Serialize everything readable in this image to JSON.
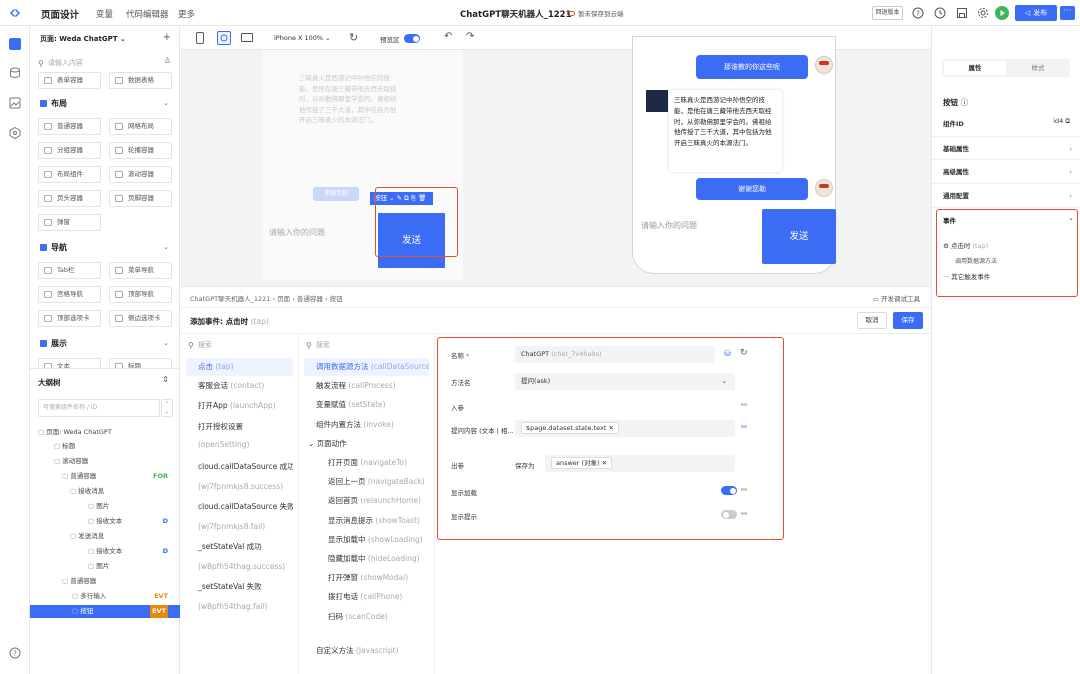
{
  "topbar": {
    "title": "页面设计",
    "nav": [
      "变量",
      "代码编辑器",
      "更多"
    ],
    "app_name": "ChatGPT聊天机器人_1221",
    "save_status": "暂未保存到云端",
    "rollback_label": "回退版本",
    "publish_label": "发布"
  },
  "comp_panel": {
    "page_selector": "页面: Weda ChatGPT",
    "search_placeholder": "请输入内容",
    "top_items": [
      "表单容器",
      "数据表格"
    ],
    "categories": [
      {
        "name": "布局",
        "items": [
          "普通容器",
          "网格布局",
          "分组容器",
          "轮播容器",
          "布局组件",
          "滚动容器",
          "页头容器",
          "页脚容器",
          "弹窗"
        ]
      },
      {
        "name": "导航",
        "items": [
          "Tab栏",
          "菜单导航",
          "宫格导航",
          "顶部导航",
          "顶部选项卡",
          "侧边选项卡"
        ]
      },
      {
        "name": "展示",
        "items": [
          "文本",
          "标题"
        ]
      }
    ]
  },
  "outline": {
    "title": "大纲树",
    "search_placeholder": "可搜索组件名称 / ID",
    "nodes": [
      {
        "label": "页面: Weda ChatGPT",
        "tag": ""
      },
      {
        "label": "标题",
        "tag": ""
      },
      {
        "label": "滚动容器",
        "tag": ""
      },
      {
        "label": "普通容器",
        "tag": "FOR"
      },
      {
        "label": "接收消息",
        "tag": ""
      },
      {
        "label": "图片",
        "tag": ""
      },
      {
        "label": "接收文本",
        "tag": "D"
      },
      {
        "label": "发送消息",
        "tag": ""
      },
      {
        "label": "接收文本",
        "tag": "D"
      },
      {
        "label": "图片",
        "tag": ""
      },
      {
        "label": "普通容器",
        "tag": ""
      },
      {
        "label": "多行输入",
        "tag": "EVT"
      },
      {
        "label": "按钮",
        "tag": "EVT"
      }
    ]
  },
  "canvas": {
    "device": "iPhone X 100%",
    "preview_label": "预览区",
    "left_preview": {
      "received_text": "三昧真火是西游记中孙悟空的技能，是他在唐三藏带他去西天取经时，从孙勤佛那里学会的。佛祖给他传授了三千大道，其中包括为他开启三昧真火的本源法门。",
      "sent_text": "谢谢您勒",
      "input_placeholder": "请输入你的问题",
      "send_label": "发送",
      "selection_label": "按钮"
    },
    "phone": {
      "msg1": "那谁教的你这些呢",
      "received_text": "三昧真火是西游记中孙悟空的技能，是他在唐三藏带他去西天取经时，从弥勒佛那里学会的。佛祖给他传授了三千大道，其中包括为他开启三昧真火的本源法门。",
      "msg2": "谢谢您勒",
      "input_placeholder": "请输入你的问题",
      "send_label": "发送"
    }
  },
  "editor": {
    "breadcrumb": [
      "ChatGPT聊天机器人_1221",
      "页面",
      "普通容器",
      "按钮"
    ],
    "dev_tools_label": "开发调试工具",
    "title": "添加事件: 点击时",
    "title_sub": "(tap)",
    "cancel_label": "取消",
    "save_label": "保存",
    "search_placeholder": "搜索",
    "events": [
      {
        "name": "点击",
        "code": "(tap)"
      },
      {
        "name": "客服会话",
        "code": "(contact)"
      },
      {
        "name": "打开App",
        "code": "(launchApp)"
      },
      {
        "name": "打开授权设置",
        "code": ""
      },
      {
        "name": "",
        "code": "(openSetting)"
      },
      {
        "name": "cloud.callDataSource 成功",
        "code": ""
      },
      {
        "name": "",
        "code": "(wj7fpnmkjs8.success)"
      },
      {
        "name": "cloud.callDataSource 失败",
        "code": ""
      },
      {
        "name": "",
        "code": "(wj7fpnmkjs8.fail)"
      },
      {
        "name": "_setStateVal 成功",
        "code": ""
      },
      {
        "name": "",
        "code": "(w8pfh54thag.success)"
      },
      {
        "name": "_setStateVal 失败",
        "code": ""
      },
      {
        "name": "",
        "code": "(w8pfh54thag.fail)"
      }
    ],
    "actions": [
      {
        "name": "调用数据源方法",
        "code": "(callDataSource)",
        "indent": 0
      },
      {
        "name": "触发流程",
        "code": "(callProcess)",
        "indent": 0
      },
      {
        "name": "变量赋值",
        "code": "(setState)",
        "indent": 0
      },
      {
        "name": "组件内置方法",
        "code": "(invoke)",
        "indent": 0
      },
      {
        "name": "页面动作",
        "code": "",
        "indent": 0
      },
      {
        "name": "打开页面",
        "code": "(navigateTo)",
        "indent": 1
      },
      {
        "name": "返回上一页",
        "code": "(navigateBack)",
        "indent": 1
      },
      {
        "name": "返回首页",
        "code": "(relaunchHome)",
        "indent": 1
      },
      {
        "name": "显示消息提示",
        "code": "(showToast)",
        "indent": 1
      },
      {
        "name": "显示加载中",
        "code": "(showLoading)",
        "indent": 1
      },
      {
        "name": "隐藏加载中",
        "code": "(hideLoading)",
        "indent": 1
      },
      {
        "name": "打开弹窗",
        "code": "(showModal)",
        "indent": 1
      },
      {
        "name": "拨打电话",
        "code": "(callPhone)",
        "indent": 1
      },
      {
        "name": "扫码",
        "code": "(scanCode)",
        "indent": 1
      },
      {
        "name": "自定义方法",
        "code": "(Javascript)",
        "indent": 0
      }
    ],
    "form": {
      "name_label": "名称",
      "name_value": "ChatGPT",
      "name_hint": "(chat_7v4ha9s)",
      "method_label": "方法名",
      "method_value": "提问(ask)",
      "input_label": "入参",
      "question_label": "提问内容 (文本 | 相...",
      "question_value": "$page.dataset.state.text",
      "output_label": "出参",
      "save_as_label": "保存为",
      "save_as_value": "answer (对象)",
      "show_loading_label": "显示加载",
      "show_loading": true,
      "show_tip_label": "显示提示",
      "show_tip": false
    }
  },
  "right_panel": {
    "tabs": [
      "属性",
      "样式"
    ],
    "component": "按钮",
    "id_label": "组件ID",
    "id_value": "id4",
    "sections": [
      "基础属性",
      "高级属性",
      "通用配置"
    ],
    "events_title": "事件",
    "event_name": "点击时",
    "event_code": "(tap)",
    "event_action": "调用数据源方法",
    "other_events": "其它触发事件"
  },
  "colors": {
    "accent": "#3b6cf6",
    "highlight": "#e0502a",
    "green": "#3cb55b",
    "tag_orange": "#e8890c"
  }
}
